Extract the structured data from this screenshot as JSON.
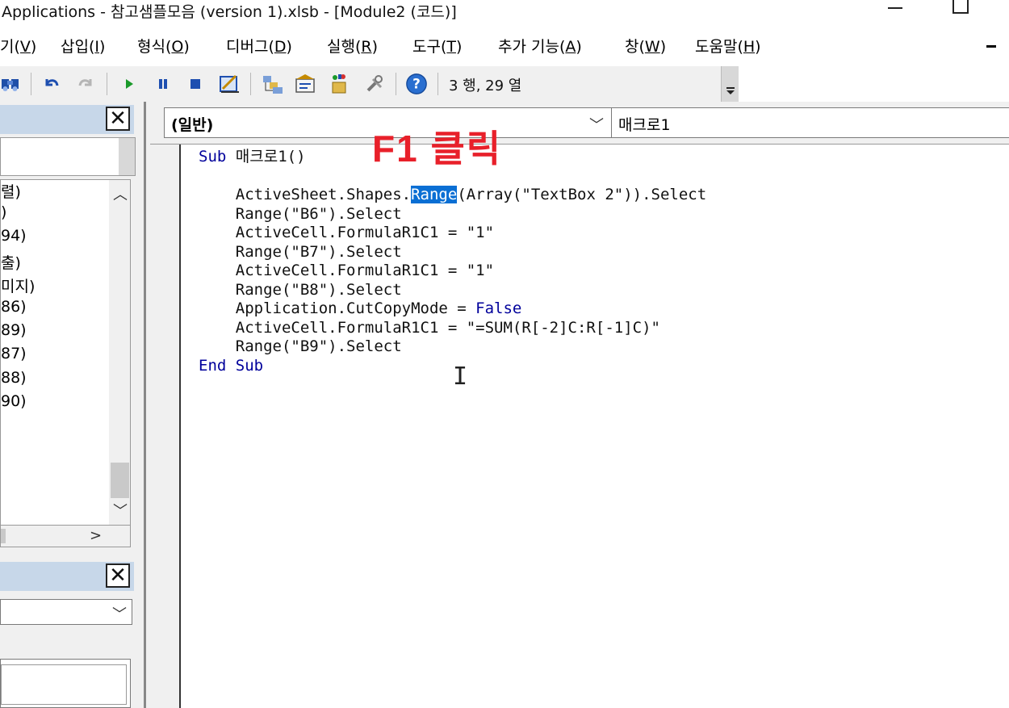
{
  "window": {
    "title": "Applications - 참고샘플모음 (version 1).xlsb - [Module2 (코드)]"
  },
  "menu": {
    "items": [
      {
        "prefix": "기(",
        "key": "V",
        "suffix": ")"
      },
      {
        "prefix": "삽입(",
        "key": "I",
        "suffix": ")"
      },
      {
        "prefix": "형식(",
        "key": "O",
        "suffix": ")"
      },
      {
        "prefix": "디버그(",
        "key": "D",
        "suffix": ")"
      },
      {
        "prefix": "실행(",
        "key": "R",
        "suffix": ")"
      },
      {
        "prefix": "도구(",
        "key": "T",
        "suffix": ")"
      },
      {
        "prefix": "추가 기능(",
        "key": "A",
        "suffix": ")"
      },
      {
        "prefix": "창(",
        "key": "W",
        "suffix": ")"
      },
      {
        "prefix": "도움말(",
        "key": "H",
        "suffix": ")"
      }
    ]
  },
  "toolbar": {
    "icons": [
      "find-icon",
      "undo-icon",
      "redo-icon",
      "run-icon",
      "break-icon",
      "reset-icon",
      "design-mode-icon",
      "project-explorer-icon",
      "properties-icon",
      "object-browser-icon",
      "toolbox-icon",
      "help-icon"
    ],
    "position_status": "3 행, 29 열"
  },
  "project_panel": {
    "items": [
      "렬)",
      ")",
      "94)",
      "출)",
      "미지)",
      "86)",
      "89)",
      "87)",
      "88)",
      "90)"
    ]
  },
  "code_window": {
    "object_combo": "(일반)",
    "procedure_combo": "매크로1",
    "annotation": "F1 클릭",
    "lines": [
      [
        {
          "t": "Sub",
          "c": "kw"
        },
        {
          "t": " 매크로1()",
          "c": ""
        }
      ],
      [
        {
          "t": "",
          "c": ""
        }
      ],
      [
        {
          "t": "    ActiveSheet.Shapes.",
          "c": ""
        },
        {
          "t": "Range",
          "c": "hl"
        },
        {
          "t": "(Array(\"TextBox 2\")).Select",
          "c": ""
        }
      ],
      [
        {
          "t": "    Range(\"B6\").Select",
          "c": ""
        }
      ],
      [
        {
          "t": "    ActiveCell.FormulaR1C1 = \"1\"",
          "c": ""
        }
      ],
      [
        {
          "t": "    Range(\"B7\").Select",
          "c": ""
        }
      ],
      [
        {
          "t": "    ActiveCell.FormulaR1C1 = \"1\"",
          "c": ""
        }
      ],
      [
        {
          "t": "    Range(\"B8\").Select",
          "c": ""
        }
      ],
      [
        {
          "t": "    Application.CutCopyMode = ",
          "c": ""
        },
        {
          "t": "False",
          "c": "kw"
        }
      ],
      [
        {
          "t": "    ActiveCell.FormulaR1C1 = \"=SUM(R[-2]C:R[-1]C)\"",
          "c": ""
        }
      ],
      [
        {
          "t": "    Range(\"B9\").Select",
          "c": ""
        }
      ],
      [
        {
          "t": "End Sub",
          "c": "kw"
        }
      ]
    ]
  },
  "colors": {
    "keyword": "#00009b",
    "selection": "#0a6fd4",
    "annotation": "#e8202a",
    "panel_header": "#c7d7e9"
  }
}
